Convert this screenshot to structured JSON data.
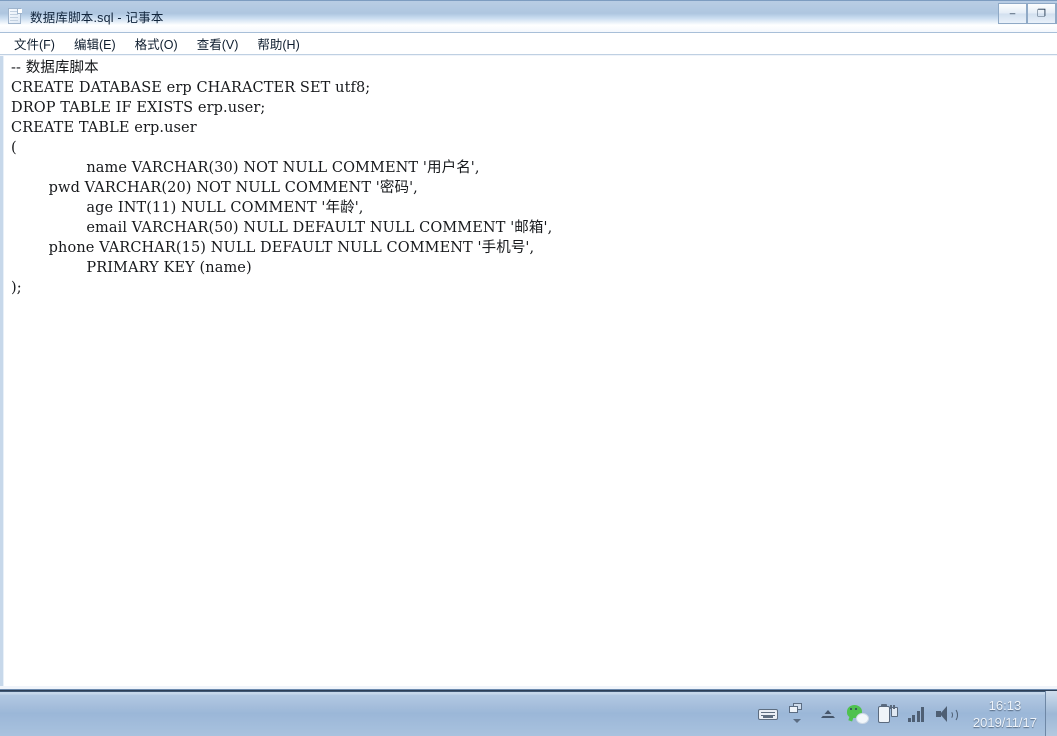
{
  "window": {
    "title": "数据库脚本.sql - 记事本",
    "icon": "notepad-document-icon",
    "controls": {
      "minimize": "–",
      "maximize": "❐",
      "close": "✕"
    }
  },
  "menubar": {
    "items": [
      {
        "label": "文件(F)",
        "name": "menu-file"
      },
      {
        "label": "编辑(E)",
        "name": "menu-edit"
      },
      {
        "label": "格式(O)",
        "name": "menu-format"
      },
      {
        "label": "查看(V)",
        "name": "menu-view"
      },
      {
        "label": "帮助(H)",
        "name": "menu-help"
      }
    ]
  },
  "editor": {
    "lines": [
      "-- 数据库脚本",
      "CREATE DATABASE erp CHARACTER SET utf8;",
      "DROP TABLE IF EXISTS erp.user;",
      "CREATE TABLE erp.user",
      "(",
      "\t\tname VARCHAR(30) NOT NULL COMMENT '用户名',",
      "\tpwd VARCHAR(20) NOT NULL COMMENT '密码',",
      "\t\tage INT(11) NULL COMMENT '年龄',",
      "\t\temail VARCHAR(50) NULL DEFAULT NULL COMMENT '邮箱',",
      "\tphone VARCHAR(15) NULL DEFAULT NULL COMMENT '手机号',",
      "\t\tPRIMARY KEY (name)",
      ");"
    ],
    "full_text": "-- 数据库脚本\nCREATE DATABASE erp CHARACTER SET utf8;\nDROP TABLE IF EXISTS erp.user;\nCREATE TABLE erp.user\n(\n\t\tname VARCHAR(30) NOT NULL COMMENT '用户名',\n\tpwd VARCHAR(20) NOT NULL COMMENT '密码',\n\t\tage INT(11) NULL COMMENT '年龄',\n\t\temail VARCHAR(50) NULL DEFAULT NULL COMMENT '邮箱',\n\tphone VARCHAR(15) NULL DEFAULT NULL COMMENT '手机号',\n\t\tPRIMARY KEY (name)\n);"
  },
  "taskbar": {
    "tray_icons": [
      {
        "name": "ime-keyboard-icon"
      },
      {
        "name": "window-switcher-icon"
      },
      {
        "name": "show-hidden-icons-chevron-up-icon"
      },
      {
        "name": "wechat-icon"
      },
      {
        "name": "battery-charging-icon"
      },
      {
        "name": "signal-strength-icon"
      },
      {
        "name": "volume-speaker-icon"
      }
    ],
    "clock": {
      "time": "16:13",
      "date": "2019/11/17"
    }
  },
  "colors": {
    "titlebar_top": "#b9cde4",
    "taskbar": "#9bb7d8",
    "editor_bg": "#ffffff",
    "text": "#17191c",
    "wechat_green": "#4fc24f"
  }
}
